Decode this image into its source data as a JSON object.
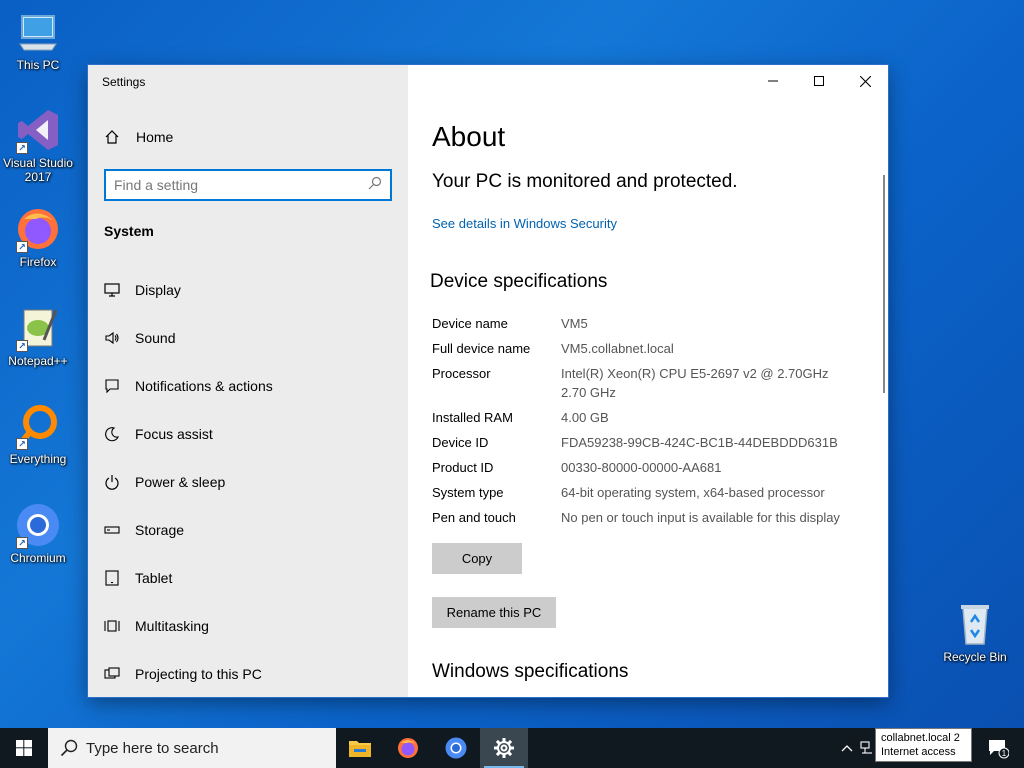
{
  "desktop": {
    "icons": [
      {
        "label": "This PC",
        "icon": "computer-icon"
      },
      {
        "label": "Visual Studio 2017",
        "icon": "visual-studio-icon"
      },
      {
        "label": "Firefox",
        "icon": "firefox-icon"
      },
      {
        "label": "Notepad++",
        "icon": "notepadpp-icon"
      },
      {
        "label": "Everything",
        "icon": "everything-search-icon"
      },
      {
        "label": "Chromium",
        "icon": "chromium-icon"
      },
      {
        "label": "Recycle Bin",
        "icon": "recycle-bin-icon"
      }
    ],
    "colors": {
      "background": "#0b63c9"
    }
  },
  "window": {
    "title": "Settings",
    "controls": {
      "minimize": "minimize-icon",
      "maximize": "maximize-icon",
      "close": "close-icon"
    }
  },
  "sidebar": {
    "home_label": "Home",
    "search_placeholder": "Find a setting",
    "section": "System",
    "items": [
      {
        "label": "Display",
        "icon": "monitor-icon"
      },
      {
        "label": "Sound",
        "icon": "speaker-icon"
      },
      {
        "label": "Notifications & actions",
        "icon": "notifications-icon"
      },
      {
        "label": "Focus assist",
        "icon": "moon-icon"
      },
      {
        "label": "Power & sleep",
        "icon": "power-icon"
      },
      {
        "label": "Storage",
        "icon": "storage-icon"
      },
      {
        "label": "Tablet",
        "icon": "tablet-icon"
      },
      {
        "label": "Multitasking",
        "icon": "multitasking-icon"
      },
      {
        "label": "Projecting to this PC",
        "icon": "projecting-icon"
      }
    ]
  },
  "main": {
    "title": "About",
    "protection_status": "Your PC is monitored and protected.",
    "security_link": "See details in Windows Security",
    "device_specs_heading": "Device specifications",
    "specs": [
      {
        "key": "Device name",
        "value": "VM5"
      },
      {
        "key": "Full device name",
        "value": "VM5.collabnet.local"
      },
      {
        "key": "Processor",
        "value": "Intel(R) Xeon(R) CPU E5-2697 v2 @ 2.70GHz 2.70 GHz"
      },
      {
        "key": "Installed RAM",
        "value": "4.00 GB"
      },
      {
        "key": "Device ID",
        "value": "FDA59238-99CB-424C-BC1B-44DEBDDD631B"
      },
      {
        "key": "Product ID",
        "value": "00330-80000-00000-AA681"
      },
      {
        "key": "System type",
        "value": "64-bit operating system, x64-based processor"
      },
      {
        "key": "Pen and touch",
        "value": "No pen or touch input is available for this display"
      }
    ],
    "copy_button": "Copy",
    "rename_button": "Rename this PC",
    "windows_specs_heading": "Windows specifications"
  },
  "taskbar": {
    "search_placeholder": "Type here to search",
    "apps": [
      {
        "name": "File Explorer",
        "icon": "folder-icon"
      },
      {
        "name": "Firefox",
        "icon": "firefox-icon"
      },
      {
        "name": "Chromium",
        "icon": "chromium-icon"
      },
      {
        "name": "Settings",
        "icon": "gear-icon",
        "active": true
      }
    ],
    "network_tooltip_line1": "collabnet.local 2",
    "network_tooltip_line2": "Internet access",
    "notification_count": "1"
  }
}
